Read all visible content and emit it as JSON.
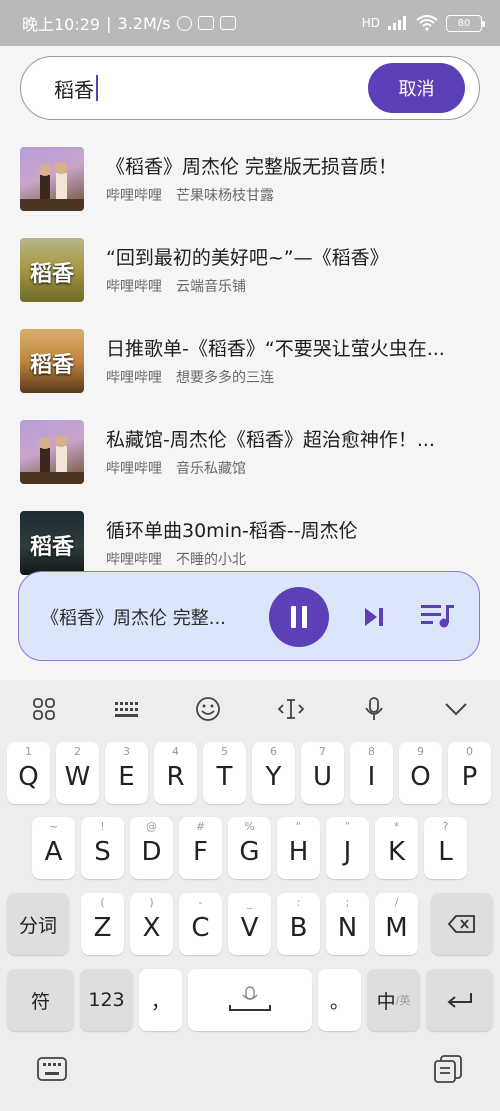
{
  "status_bar": {
    "time": "晚上10:29",
    "speed": "3.2M/s",
    "network": "HD",
    "battery": "80"
  },
  "search": {
    "query": "稻香",
    "cancel_label": "取消"
  },
  "results": [
    {
      "title": "《稻香》周杰伦 完整版无损音质！",
      "source": "哔哩哔哩",
      "uploader": "芒果味杨枝甘露",
      "thumb_caption": ""
    },
    {
      "title": "“回到最初的美好吧~”—《稻香》",
      "source": "哔哩哔哩",
      "uploader": "云端音乐铺",
      "thumb_caption": "稻香"
    },
    {
      "title": "日推歌单-《稻香》“不要哭让萤火虫在...",
      "source": "哔哩哔哩",
      "uploader": "想要多多的三连",
      "thumb_caption": "稻香"
    },
    {
      "title": "私藏馆-周杰伦《稻香》超治愈神作！...",
      "source": "哔哩哔哩",
      "uploader": "音乐私藏馆",
      "thumb_caption": ""
    },
    {
      "title": "循环单曲30min-稻香--周杰伦",
      "source": "哔哩哔哩",
      "uploader": "不睡的小北",
      "thumb_caption": "稻香"
    }
  ],
  "player": {
    "now_playing": "《稻香》周杰伦 完整...",
    "play_icon": "pause-icon",
    "next_icon": "skip-next-icon",
    "playlist_icon": "playlist-icon",
    "accent": "#5d3fb7"
  },
  "keyboard": {
    "row1": [
      {
        "k": "Q",
        "h": "1"
      },
      {
        "k": "W",
        "h": "2"
      },
      {
        "k": "E",
        "h": "3"
      },
      {
        "k": "R",
        "h": "4"
      },
      {
        "k": "T",
        "h": "5"
      },
      {
        "k": "Y",
        "h": "6"
      },
      {
        "k": "U",
        "h": "7"
      },
      {
        "k": "I",
        "h": "8"
      },
      {
        "k": "O",
        "h": "9"
      },
      {
        "k": "P",
        "h": "0"
      }
    ],
    "row2": [
      {
        "k": "A",
        "h": "~"
      },
      {
        "k": "S",
        "h": "!"
      },
      {
        "k": "D",
        "h": "@"
      },
      {
        "k": "F",
        "h": "#"
      },
      {
        "k": "G",
        "h": "%"
      },
      {
        "k": "H",
        "h": "“"
      },
      {
        "k": "J",
        "h": "”"
      },
      {
        "k": "K",
        "h": "*"
      },
      {
        "k": "L",
        "h": "?"
      }
    ],
    "row3": [
      {
        "k": "Z",
        "h": "("
      },
      {
        "k": "X",
        "h": ")"
      },
      {
        "k": "C",
        "h": "-"
      },
      {
        "k": "V",
        "h": "_"
      },
      {
        "k": "B",
        "h": ":"
      },
      {
        "k": "N",
        "h": ";"
      },
      {
        "k": "M",
        "h": "/"
      }
    ],
    "fenci_label": "分词",
    "symbol_label": "符",
    "num_label": "123",
    "comma_label": "，",
    "period_label": "。",
    "lang_label": "中",
    "lang_sub_label": "/英"
  }
}
